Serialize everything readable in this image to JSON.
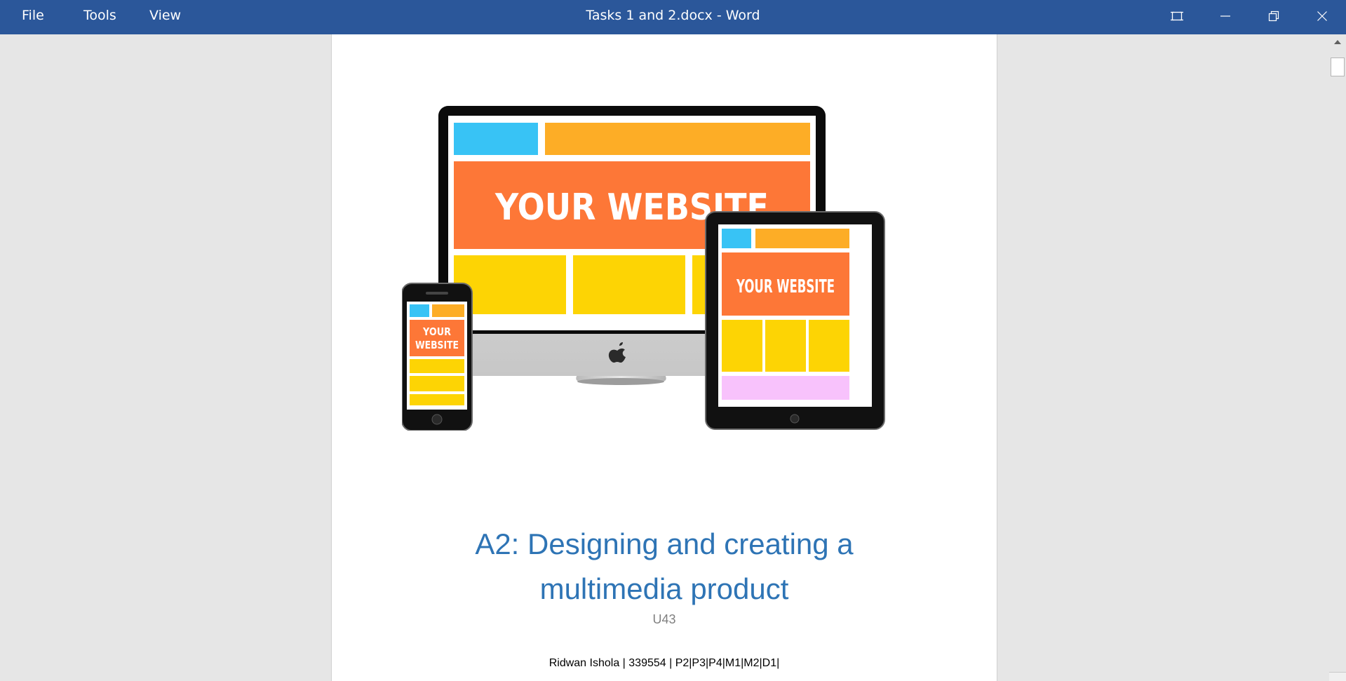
{
  "menu": {
    "file": "File",
    "tools": "Tools",
    "view": "View"
  },
  "window": {
    "title": "Tasks 1 and 2.docx  -  Word"
  },
  "window_controls": [
    "focus-mode-icon",
    "minimize-icon",
    "restore-icon",
    "close-icon"
  ],
  "document": {
    "hero_image": {
      "monitor_text": "YOUR WEBSITE",
      "tablet_text": "YOUR WEBSITE",
      "phone_text_line1": "YOUR",
      "phone_text_line2": "WEBSITE"
    },
    "title_line1": "A2: Designing and creating a",
    "title_line2": "multimedia product",
    "subtitle": "U43",
    "byline": "Ridwan Ishola | 339554 | P2|P3|P4|M1|M2|D1|"
  },
  "colors": {
    "titlebar": "#2b579a",
    "heading": "#2e74b5",
    "site_blue": "#38c3f5",
    "site_orange_light": "#fdad26",
    "site_orange": "#fd7737",
    "site_yellow": "#fdd404",
    "site_pink": "#f8c2fc"
  }
}
